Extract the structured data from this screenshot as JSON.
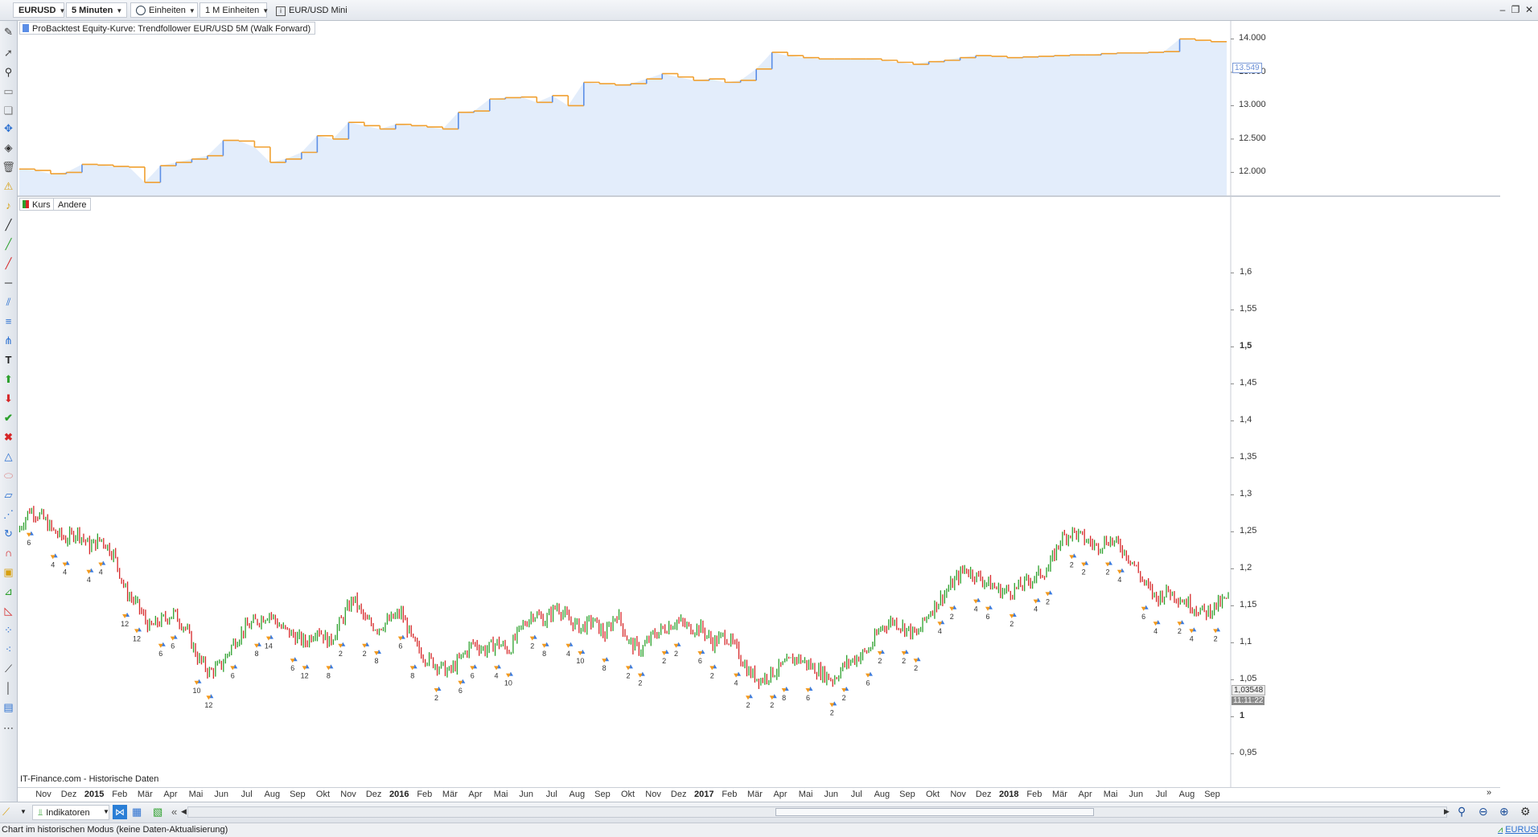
{
  "topbar": {
    "symbol": "EURUSD",
    "timeframe": "5 Minuten",
    "units": "Einheiten",
    "units_count": "1 M Einheiten",
    "instrument": "EUR/USD Mini"
  },
  "equity_panel": {
    "legend": "ProBacktest Equity-Kurve: Trendfollower EUR/USD 5M (Walk Forward)",
    "last_value_tag": "13.549",
    "colors": {
      "up": "#5b8ee6",
      "flat": "#f0a030",
      "fill": "#e3edfb"
    }
  },
  "price_panel": {
    "legend_kurs": "Kurs",
    "legend_andere": "Andere",
    "price_tag": "1,03548",
    "time_tag": "11:11:22",
    "watermark": "IT-Finance.com - Historische Daten",
    "colors": {
      "up": "#2ca02c",
      "down": "#d62728",
      "buy": "#3a7be0",
      "sell": "#f39a1e"
    }
  },
  "chart_data": [
    {
      "type": "area",
      "title": "ProBacktest Equity-Kurve: Trendfollower EUR/USD 5M (Walk Forward)",
      "ylim": [
        11800,
        14150
      ],
      "yticks": [
        "12.000",
        "12.500",
        "13.000",
        "13.500",
        "14.000"
      ],
      "ytick_values": [
        12000,
        12500,
        13000,
        13500,
        14000
      ],
      "series": [
        {
          "values": [
            12050,
            12030,
            11980,
            12000,
            12120,
            12110,
            12090,
            12080,
            11850,
            12100,
            12150,
            12200,
            12250,
            12480,
            12470,
            12380,
            12150,
            12200,
            12300,
            12550,
            12500,
            12750,
            12700,
            12650,
            12720,
            12700,
            12680,
            12650,
            12900,
            12920,
            13100,
            13120,
            13130,
            13050,
            13150,
            13000,
            13350,
            13330,
            13310,
            13330,
            13400,
            13480,
            13430,
            13380,
            13400,
            13350,
            13380,
            13550,
            13800,
            13750,
            13720,
            13700,
            13700,
            13700,
            13700,
            13680,
            13650,
            13620,
            13660,
            13680,
            13720,
            13750,
            13740,
            13720,
            13730,
            13740,
            13750,
            13760,
            13760,
            13780,
            13790,
            13790,
            13800,
            13810,
            14000,
            13980,
            13960,
            13960
          ]
        }
      ]
    },
    {
      "type": "line",
      "title": "EURUSD",
      "x_labels": [
        "Nov",
        "Dez",
        "2015",
        "Feb",
        "Mär",
        "Apr",
        "Mai",
        "Jun",
        "Jul",
        "Aug",
        "Sep",
        "Okt",
        "Nov",
        "Dez",
        "2016",
        "Feb",
        "Mär",
        "Apr",
        "Mai",
        "Jun",
        "Jul",
        "Aug",
        "Sep",
        "Okt",
        "Nov",
        "Dez",
        "2017",
        "Feb",
        "Mär",
        "Apr",
        "Mai",
        "Jun",
        "Jul",
        "Aug",
        "Sep",
        "Okt",
        "Nov",
        "Dez",
        "2018",
        "Feb",
        "Mär",
        "Apr",
        "Mai",
        "Jun",
        "Jul",
        "Aug",
        "Sep"
      ],
      "year_labels": [
        "2015",
        "2016",
        "2017",
        "2018"
      ],
      "ylim": [
        0.92,
        1.67
      ],
      "yticks": [
        "1,6",
        "1,55",
        "1,5",
        "1,45",
        "1,4",
        "1,35",
        "1,3",
        "1,25",
        "1,2",
        "1,15",
        "1,1",
        "1,05",
        "1",
        "0,95"
      ],
      "ytick_values": [
        1.6,
        1.55,
        1.5,
        1.45,
        1.4,
        1.35,
        1.3,
        1.25,
        1.2,
        1.15,
        1.1,
        1.05,
        1.0,
        0.95
      ],
      "series": [
        {
          "name": "Kurs",
          "values": [
            1.25,
            1.28,
            1.27,
            1.25,
            1.24,
            1.25,
            1.23,
            1.24,
            1.22,
            1.17,
            1.15,
            1.12,
            1.13,
            1.14,
            1.12,
            1.08,
            1.06,
            1.07,
            1.1,
            1.12,
            1.13,
            1.14,
            1.12,
            1.11,
            1.1,
            1.12,
            1.1,
            1.13,
            1.16,
            1.13,
            1.12,
            1.13,
            1.14,
            1.1,
            1.08,
            1.07,
            1.06,
            1.08,
            1.1,
            1.09,
            1.1,
            1.09,
            1.12,
            1.14,
            1.13,
            1.15,
            1.13,
            1.12,
            1.13,
            1.11,
            1.14,
            1.1,
            1.09,
            1.11,
            1.12,
            1.13,
            1.12,
            1.12,
            1.1,
            1.11,
            1.09,
            1.06,
            1.05,
            1.06,
            1.07,
            1.08,
            1.07,
            1.06,
            1.05,
            1.07,
            1.08,
            1.09,
            1.12,
            1.13,
            1.12,
            1.11,
            1.14,
            1.16,
            1.18,
            1.2,
            1.19,
            1.18,
            1.17,
            1.17,
            1.18,
            1.19,
            1.2,
            1.24,
            1.25,
            1.24,
            1.23,
            1.24,
            1.23,
            1.21,
            1.18,
            1.16,
            1.17,
            1.16,
            1.15,
            1.14,
            1.15,
            1.16
          ]
        }
      ],
      "trade_labels": [
        "6",
        "4",
        "4",
        "4",
        "4",
        "12",
        "12",
        "6",
        "6",
        "10",
        "12",
        "6",
        "8",
        "14",
        "6",
        "12",
        "8",
        "2",
        "2",
        "8",
        "6",
        "8",
        "2",
        "6",
        "6",
        "4",
        "10",
        "2",
        "8",
        "4",
        "10",
        "8",
        "2",
        "2",
        "2",
        "2",
        "6",
        "2",
        "4",
        "2",
        "2",
        "8",
        "6",
        "2",
        "2",
        "6",
        "2",
        "2",
        "2",
        "4",
        "2",
        "4",
        "6",
        "2",
        "4",
        "2",
        "2",
        "2",
        "2",
        "4",
        "6",
        "4",
        "2",
        "4",
        "2"
      ]
    }
  ],
  "xaxis_labels": [
    "Nov",
    "Dez",
    "2015",
    "Feb",
    "Mär",
    "Apr",
    "Mai",
    "Jun",
    "Jul",
    "Aug",
    "Sep",
    "Okt",
    "Nov",
    "Dez",
    "2016",
    "Feb",
    "Mär",
    "Apr",
    "Mai",
    "Jun",
    "Jul",
    "Aug",
    "Sep",
    "Okt",
    "Nov",
    "Dez",
    "2017",
    "Feb",
    "Mär",
    "Apr",
    "Mai",
    "Jun",
    "Jul",
    "Aug",
    "Sep",
    "Okt",
    "Nov",
    "Dez",
    "2018",
    "Feb",
    "Mär",
    "Apr",
    "Mai",
    "Jun",
    "Jul",
    "Aug",
    "Sep"
  ],
  "bottombar": {
    "indicators_label": "Indikatoren",
    "status": "Chart im historischen Modus (keine Daten-Aktualisierung)",
    "symbol_link": "EURUSD"
  },
  "icons": [
    "pen-icon",
    "cursor-icon",
    "zoom-icon",
    "ruler-icon",
    "copy-icon",
    "move-icon",
    "erase-icon",
    "trash-icon",
    "alert-icon",
    "bell-icon",
    "line-icon",
    "green-line-icon",
    "red-line-icon",
    "hline-icon",
    "channel-icon",
    "fib-icon",
    "text-icon",
    "buy-arrow-icon",
    "sell-arrow-icon",
    "check-icon",
    "cross-icon"
  ]
}
